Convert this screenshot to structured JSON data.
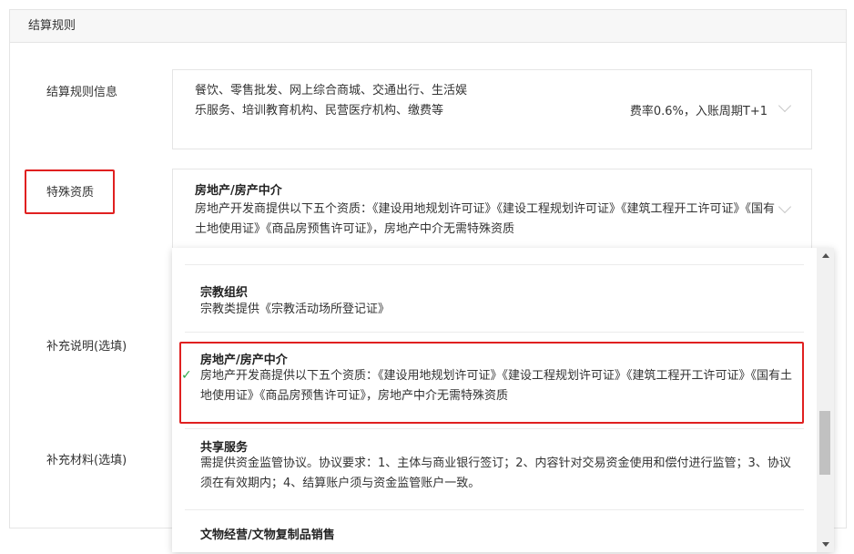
{
  "section": {
    "title": "结算规则"
  },
  "rule_info": {
    "label": "结算规则信息",
    "text": "餐饮、零售批发、网上综合商城、交通出行、生活娱乐服务、培训教育机构、民营医疗机构、缴费等",
    "fee": "费率0.6%，入账周期T+1"
  },
  "special_qualification": {
    "label": "特殊资质",
    "selected_title": "房地产/房产中介",
    "selected_desc": "房地产开发商提供以下五个资质：《建设用地规划许可证》《建设工程规划许可证》《建筑工程开工许可证》《国有土地使用证》《商品房预售许可证》，房地产中介无需特殊资质"
  },
  "supplement_note": {
    "label": "补充说明(选填)"
  },
  "supplement_material": {
    "label": "补充材料(选填)"
  },
  "dropdown": {
    "options": [
      {
        "title": "宗教组织",
        "desc": "宗教类提供《宗教活动场所登记证》"
      },
      {
        "title": "房地产/房产中介",
        "desc": "房地产开发商提供以下五个资质：《建设用地规划许可证》《建设工程规划许可证》《建筑工程开工许可证》《国有土地使用证》《商品房预售许可证》，房地产中介无需特殊资质",
        "selected": true,
        "check": "✓"
      },
      {
        "title": "共享服务",
        "desc": "需提供资金监管协议。协议要求：1、主体与商业银行签订；2、内容针对交易资金使用和偿付进行监管；3、协议须在有效期内；4、结算账户须与资金监管账户一致。"
      },
      {
        "title": "文物经营/文物复制品销售",
        "desc": ""
      }
    ]
  },
  "colors": {
    "highlight_border": "#e02020",
    "check": "#2eaa4a"
  }
}
